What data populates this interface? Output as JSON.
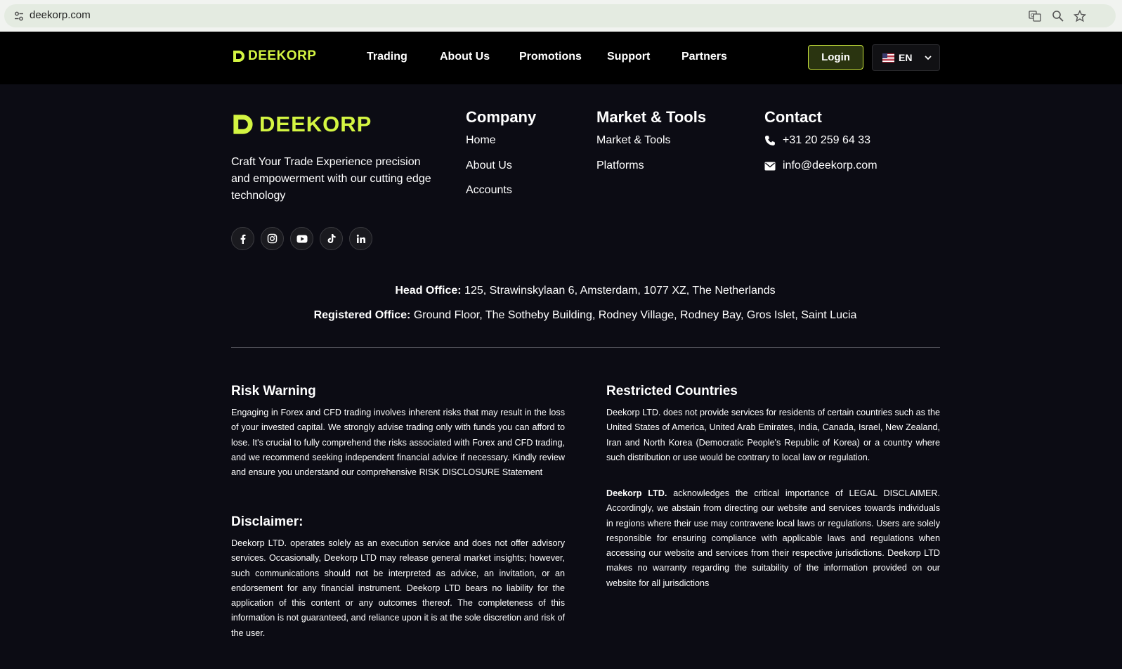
{
  "browser": {
    "url": "deekorp.com",
    "icons": [
      "tune-icon",
      "translate-icon",
      "zoom-icon",
      "bookmark-star-icon"
    ]
  },
  "header": {
    "logo": "DEEKORP",
    "nav": [
      "Trading",
      "About Us",
      "Promotions",
      "Support",
      "Partners"
    ],
    "login_label": "Login",
    "language": "EN"
  },
  "footer": {
    "logo": "DEEKORP",
    "tagline": "Craft Your Trade Experience precision and empowerment with our cutting edge technology",
    "social": [
      "facebook-icon",
      "instagram-icon",
      "youtube-icon",
      "tiktok-icon",
      "linkedin-icon"
    ],
    "company": {
      "heading": "Company",
      "links": [
        "Home",
        "About Us",
        "Accounts"
      ]
    },
    "market": {
      "heading": "Market & Tools",
      "links": [
        "Market & Tools",
        "Platforms"
      ]
    },
    "contact": {
      "heading": "Contact",
      "phone": "+31 20 259 64 33",
      "email": "info@deekorp.com"
    },
    "head_office": {
      "label": "Head Office:",
      "value": "125, Strawinskylaan 6, Amsterdam, 1077 XZ, The Netherlands"
    },
    "registered_office": {
      "label": "Registered Office:",
      "value": "Ground Floor, The Sotheby Building, Rodney Village, Rodney Bay, Gros Islet, Saint Lucia"
    },
    "risk_warning": {
      "heading": "Risk Warning",
      "text": "Engaging in Forex and CFD trading involves inherent risks that may result in the loss of your invested capital. We strongly advise trading only with funds you can afford to lose. It's crucial to fully comprehend the risks associated with Forex and CFD trading, and we recommend seeking independent financial advice if necessary. Kindly review and ensure you understand our comprehensive RISK DISCLOSURE Statement"
    },
    "disclaimer": {
      "heading": "Disclaimer:",
      "text": "Deekorp LTD. operates solely as an execution service and does not offer advisory services. Occasionally, Deekorp LTD may release general market insights; however, such communications should not be interpreted as advice, an invitation, or an endorsement for any financial instrument. Deekorp LTD bears no liability for the application of this content or any outcomes thereof. The completeness of this information is not guaranteed, and reliance upon it is at the sole discretion and risk of the user."
    },
    "restricted": {
      "heading": "Restricted Countries",
      "text": "Deekorp LTD. does not provide services for residents of certain countries such as the United States of America, United Arab Emirates, India, Canada, Israel, New Zealand, Iran and North Korea (Democratic People's Republic of Korea) or a country where such distribution or use would be contrary to local law or regulation."
    },
    "legal": {
      "company": "Deekorp LTD.",
      "text": " acknowledges the critical importance of LEGAL DISCLAIMER. Accordingly, we abstain from directing our website and services towards individuals in regions where their use may contravene local laws or regulations. Users are solely responsible for ensuring compliance with applicable laws and regulations when accessing our website and services from their respective jurisdictions. Deekorp LTD makes no warranty regarding the suitability of the information provided on our website for all jurisdictions"
    }
  },
  "colors": {
    "brand_lime": "#d4f542",
    "page_bg": "#0c0c14",
    "header_bg": "#000000"
  }
}
